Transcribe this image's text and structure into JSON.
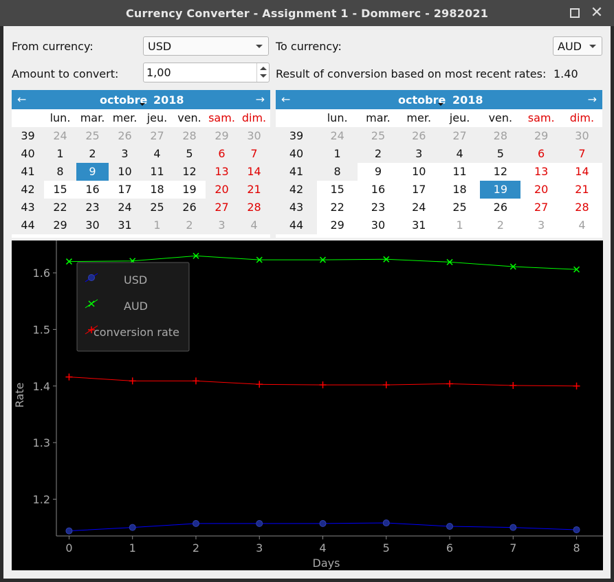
{
  "window": {
    "title": "Currency Converter - Assignment 1 - Dommerc - 2982021",
    "maximize_icon": "maximize-icon",
    "close_icon": "close-icon"
  },
  "form": {
    "from_label": "From currency:",
    "from_value": "USD",
    "to_label": "To currency:",
    "to_value": "AUD",
    "amount_label": "Amount to convert:",
    "amount_value": "1,00",
    "result_label": "Result of conversion based on most recent rates:",
    "result_value": "1.40"
  },
  "calendars": [
    {
      "month": "octobre",
      "year": "2018",
      "weekday_headers": [
        "lun.",
        "mar.",
        "mer.",
        "jeu.",
        "ven.",
        "sam.",
        "dim."
      ],
      "weeks": [
        39,
        40,
        41,
        42,
        43,
        44
      ],
      "days": [
        [
          "24",
          "25",
          "26",
          "27",
          "28",
          "29",
          "30"
        ],
        [
          "1",
          "2",
          "3",
          "4",
          "5",
          "6",
          "7"
        ],
        [
          "8",
          "9",
          "10",
          "11",
          "12",
          "13",
          "14"
        ],
        [
          "15",
          "16",
          "17",
          "18",
          "19",
          "20",
          "21"
        ],
        [
          "22",
          "23",
          "24",
          "25",
          "26",
          "27",
          "28"
        ],
        [
          "29",
          "30",
          "31",
          "1",
          "2",
          "3",
          "4"
        ]
      ],
      "selected_day": "9"
    },
    {
      "month": "octobre",
      "year": "2018",
      "weekday_headers": [
        "lun.",
        "mar.",
        "mer.",
        "jeu.",
        "ven.",
        "sam.",
        "dim."
      ],
      "weeks": [
        39,
        40,
        41,
        42,
        43,
        44
      ],
      "days": [
        [
          "24",
          "25",
          "26",
          "27",
          "28",
          "29",
          "30"
        ],
        [
          "1",
          "2",
          "3",
          "4",
          "5",
          "6",
          "7"
        ],
        [
          "8",
          "9",
          "10",
          "11",
          "12",
          "13",
          "14"
        ],
        [
          "15",
          "16",
          "17",
          "18",
          "19",
          "20",
          "21"
        ],
        [
          "22",
          "23",
          "24",
          "25",
          "26",
          "27",
          "28"
        ],
        [
          "29",
          "30",
          "31",
          "1",
          "2",
          "3",
          "4"
        ]
      ],
      "selected_day": "19"
    }
  ],
  "chart_data": {
    "type": "line",
    "xlabel": "Days",
    "ylabel": "Rate",
    "x": [
      0,
      1,
      2,
      3,
      4,
      5,
      6,
      7,
      8
    ],
    "xlim": [
      -0.2,
      8.2
    ],
    "ylim": [
      1.135,
      1.645
    ],
    "yticks": [
      1.2,
      1.3,
      1.4,
      1.5,
      1.6
    ],
    "xticks": [
      0,
      1,
      2,
      3,
      4,
      5,
      6,
      7,
      8
    ],
    "grid": false,
    "legend_position": "top-left",
    "series": [
      {
        "name": "USD",
        "color": "#0000ff",
        "marker": "circle",
        "values": [
          1.144,
          1.15,
          1.157,
          1.157,
          1.157,
          1.158,
          1.152,
          1.15,
          1.146
        ]
      },
      {
        "name": "AUD",
        "color": "#00ff00",
        "marker": "x",
        "values": [
          1.62,
          1.621,
          1.63,
          1.623,
          1.623,
          1.624,
          1.619,
          1.611,
          1.606
        ]
      },
      {
        "name": "conversion rate",
        "color": "#ff0000",
        "marker": "plus",
        "values": [
          1.416,
          1.409,
          1.409,
          1.403,
          1.402,
          1.402,
          1.404,
          1.401,
          1.4
        ]
      }
    ]
  }
}
